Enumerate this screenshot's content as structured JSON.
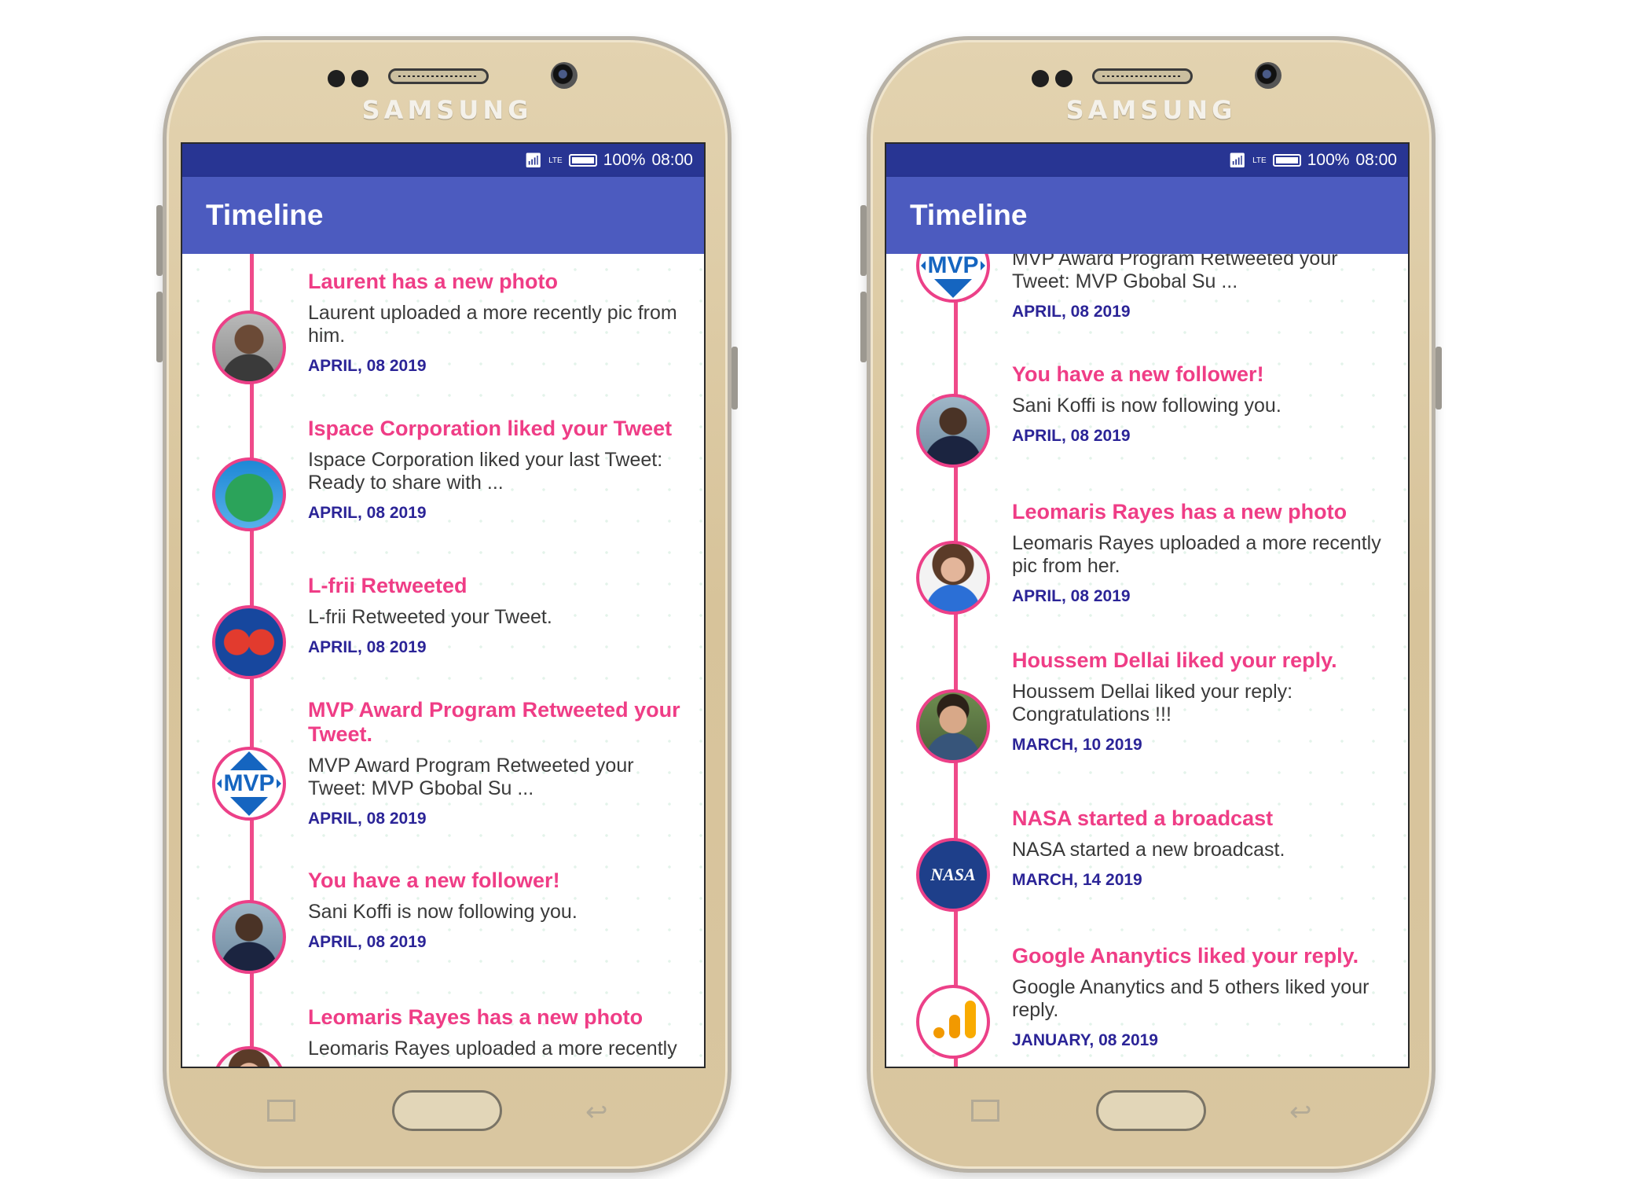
{
  "phones": [
    {
      "brand": "SAMSUNG",
      "status": {
        "battery": "100%",
        "time": "08:00",
        "network": "LTE"
      },
      "appbar_title": "Timeline",
      "items": [
        {
          "title": "Laurent has a new photo",
          "desc": "Laurent uploaded a more recently pic from him.",
          "date": "APRIL, 08 2019",
          "avatar": "photo-person"
        },
        {
          "title": "Ispace Corporation liked your Tweet",
          "desc": "Ispace Corporation liked your last Tweet: Ready to share with ...",
          "date": "APRIL, 08 2019",
          "avatar": "globe-logo"
        },
        {
          "title": "L-frii Retweeted",
          "desc": "L-frii Retweeted your Tweet.",
          "date": "APRIL, 08 2019",
          "avatar": "lfrii-logo"
        },
        {
          "title": "MVP Award Program Retweeted your Tweet.",
          "desc": "MVP Award Program Retweeted your Tweet: MVP Gbobal Su            ...",
          "date": "APRIL, 08 2019",
          "avatar": "mvp-logo",
          "avatar_text": "MVP"
        },
        {
          "title": "You have a new follower!",
          "desc": "Sani Koffi is now following you.",
          "date": "APRIL, 08 2019",
          "avatar": "photo-person"
        },
        {
          "title": "Leomaris Rayes has a new photo",
          "desc": "Leomaris Rayes uploaded a more recently",
          "date": "",
          "avatar": "photo-person"
        }
      ]
    },
    {
      "brand": "SAMSUNG",
      "status": {
        "battery": "100%",
        "time": "08:00",
        "network": "LTE"
      },
      "appbar_title": "Timeline",
      "items": [
        {
          "title": "",
          "desc": "MVP Award Program Retweeted your Tweet: MVP Gbobal Su            ...",
          "date": "APRIL, 08 2019",
          "avatar": "mvp-logo",
          "avatar_text": "MVP"
        },
        {
          "title": "You have a new follower!",
          "desc": "Sani Koffi is now following you.",
          "date": "APRIL, 08 2019",
          "avatar": "photo-person"
        },
        {
          "title": "Leomaris Rayes has a new photo",
          "desc": "Leomaris Rayes uploaded a more recently pic from her.",
          "date": "APRIL, 08 2019",
          "avatar": "photo-person"
        },
        {
          "title": "Houssem Dellai liked your reply.",
          "desc": "Houssem Dellai liked your reply: Congratulations !!!",
          "date": "MARCH, 10 2019",
          "avatar": "photo-person"
        },
        {
          "title": "NASA started a broadcast",
          "desc": "NASA started a new broadcast.",
          "date": "MARCH, 14 2019",
          "avatar": "nasa-logo",
          "avatar_text": "NASA"
        },
        {
          "title": "Google Ananytics liked your reply.",
          "desc": "Google Ananytics and 5 others liked your reply.",
          "date": "JANUARY, 08 2019",
          "avatar": "analytics-logo"
        }
      ]
    }
  ]
}
